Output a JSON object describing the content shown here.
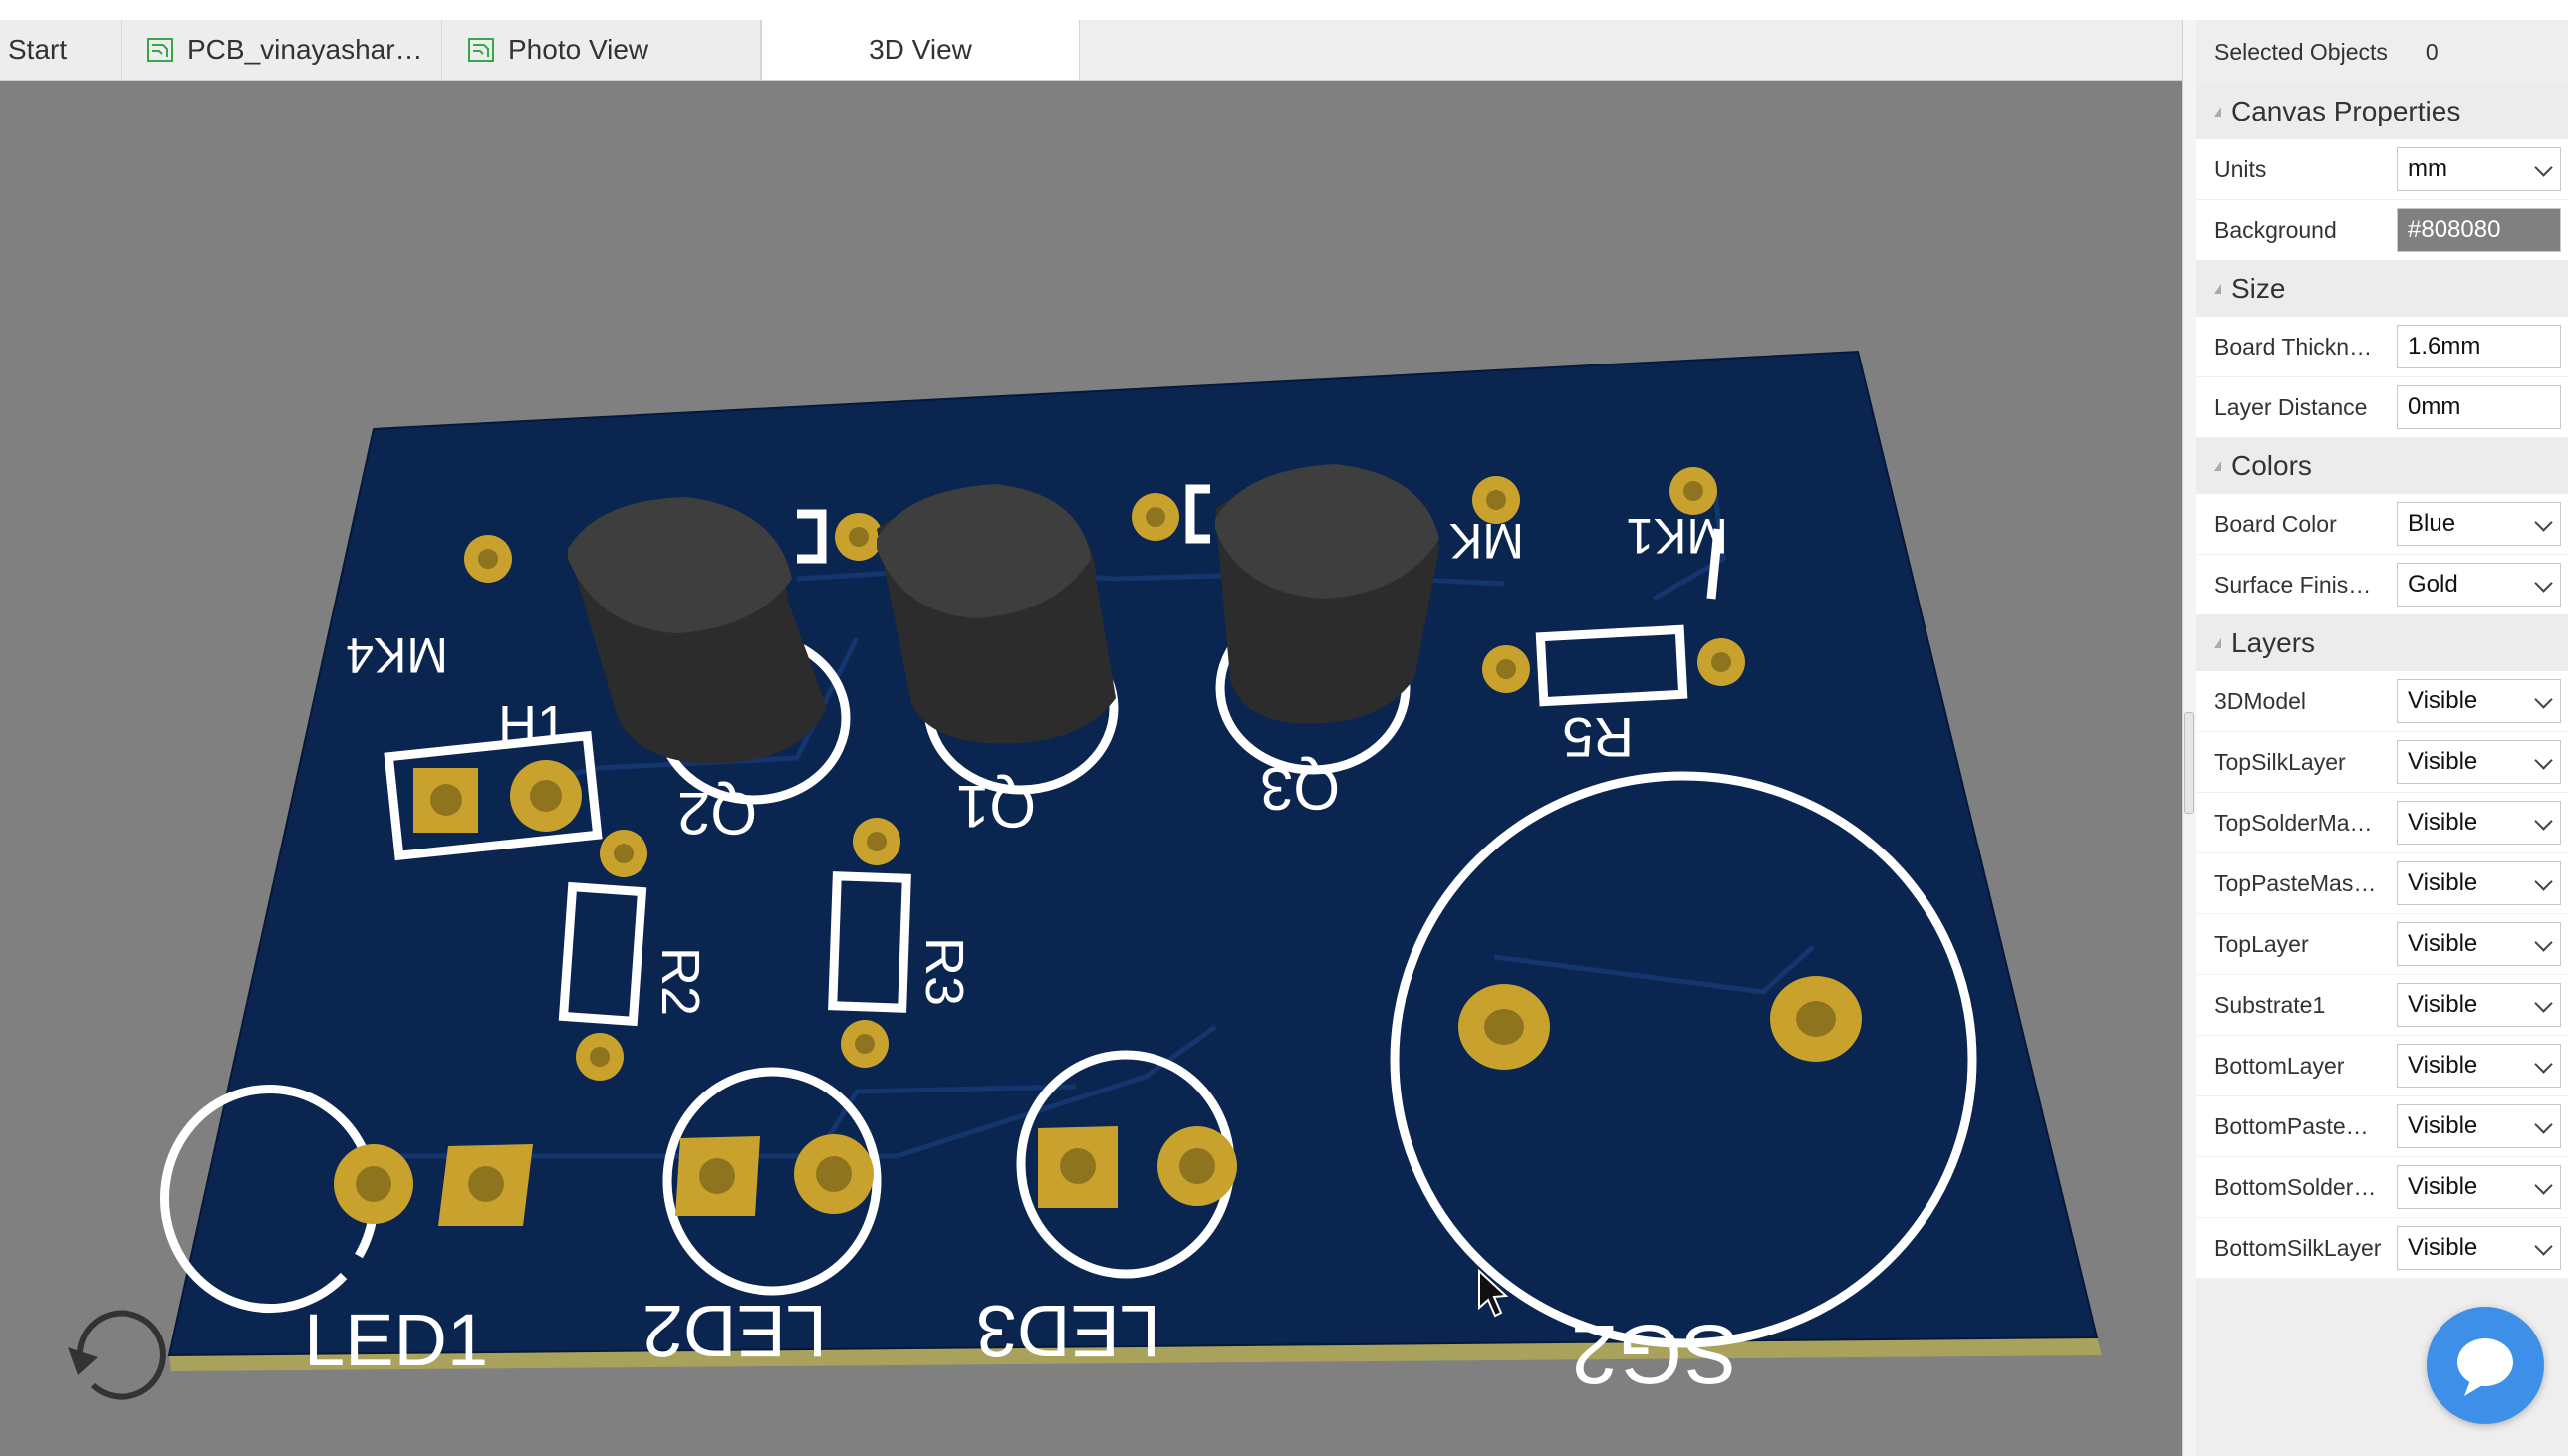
{
  "tabs": [
    {
      "label": "Start",
      "icon": "none"
    },
    {
      "label": "PCB_vinayashar…",
      "icon": "pcb-doc-icon"
    },
    {
      "label": "Photo View",
      "icon": "photo-doc-icon"
    },
    {
      "label": "3D View",
      "icon": "none",
      "active": true
    }
  ],
  "panel": {
    "selected_label": "Selected Objects",
    "selected_count": "0",
    "canvas": {
      "title": "Canvas Properties",
      "units_label": "Units",
      "units_value": "mm",
      "background_label": "Background",
      "background_value": "#808080"
    },
    "size": {
      "title": "Size",
      "thickness_label": "Board Thickn…",
      "thickness_value": "1.6mm",
      "layer_distance_label": "Layer Distance",
      "layer_distance_value": "0mm"
    },
    "colors": {
      "title": "Colors",
      "board_color_label": "Board Color",
      "board_color_value": "Blue",
      "surface_label": "Surface Finis…",
      "surface_value": "Gold"
    },
    "layers": {
      "title": "Layers",
      "items": [
        {
          "label": "3DModel",
          "value": "Visible"
        },
        {
          "label": "TopSilkLayer",
          "value": "Visible"
        },
        {
          "label": "TopSolderMa…",
          "value": "Visible"
        },
        {
          "label": "TopPasteMas…",
          "value": "Visible"
        },
        {
          "label": "TopLayer",
          "value": "Visible"
        },
        {
          "label": "Substrate1",
          "value": "Visible"
        },
        {
          "label": "BottomLayer",
          "value": "Visible"
        },
        {
          "label": "BottomPaste…",
          "value": "Visible"
        },
        {
          "label": "BottomSolder…",
          "value": "Visible"
        },
        {
          "label": "BottomSilkLayer",
          "value": "Visible"
        }
      ]
    }
  },
  "board": {
    "silk_labels": [
      "MK4",
      "MK",
      "MK1",
      "H1",
      "Q2",
      "Q1",
      "Q3",
      "R5",
      "R2",
      "R3",
      "LED1",
      "LED2",
      "LED3",
      "SG2"
    ]
  },
  "colors": {
    "canvas_bg": "#808080",
    "board": "#0a2550",
    "silk": "#ffffff",
    "pad": "#c9a22e",
    "chat": "#3d8fe8"
  }
}
